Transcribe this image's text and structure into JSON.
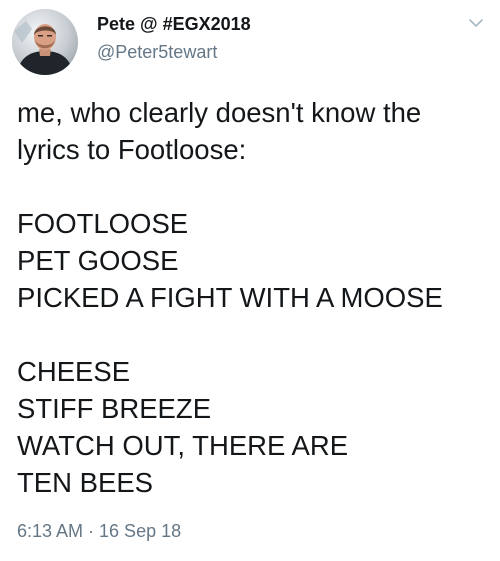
{
  "author": {
    "display_name": "Pete @ #EGX2018",
    "handle": "@Peter5tewart",
    "avatar_icon": "profile-photo"
  },
  "menu_icon": "chevron-down-icon",
  "tweet": {
    "lines": [
      "me, who clearly doesn't know the",
      "lyrics to Footloose:",
      "",
      "FOOTLOOSE",
      "PET GOOSE",
      "PICKED A FIGHT WITH A MOOSE",
      "",
      "CHEESE",
      "STIFF BREEZE",
      "WATCH OUT, THERE ARE",
      "TEN BEES"
    ]
  },
  "timestamp": "6:13 AM · 16 Sep 18",
  "colors": {
    "text": "#14171a",
    "secondary": "#657786",
    "background": "#ffffff"
  }
}
